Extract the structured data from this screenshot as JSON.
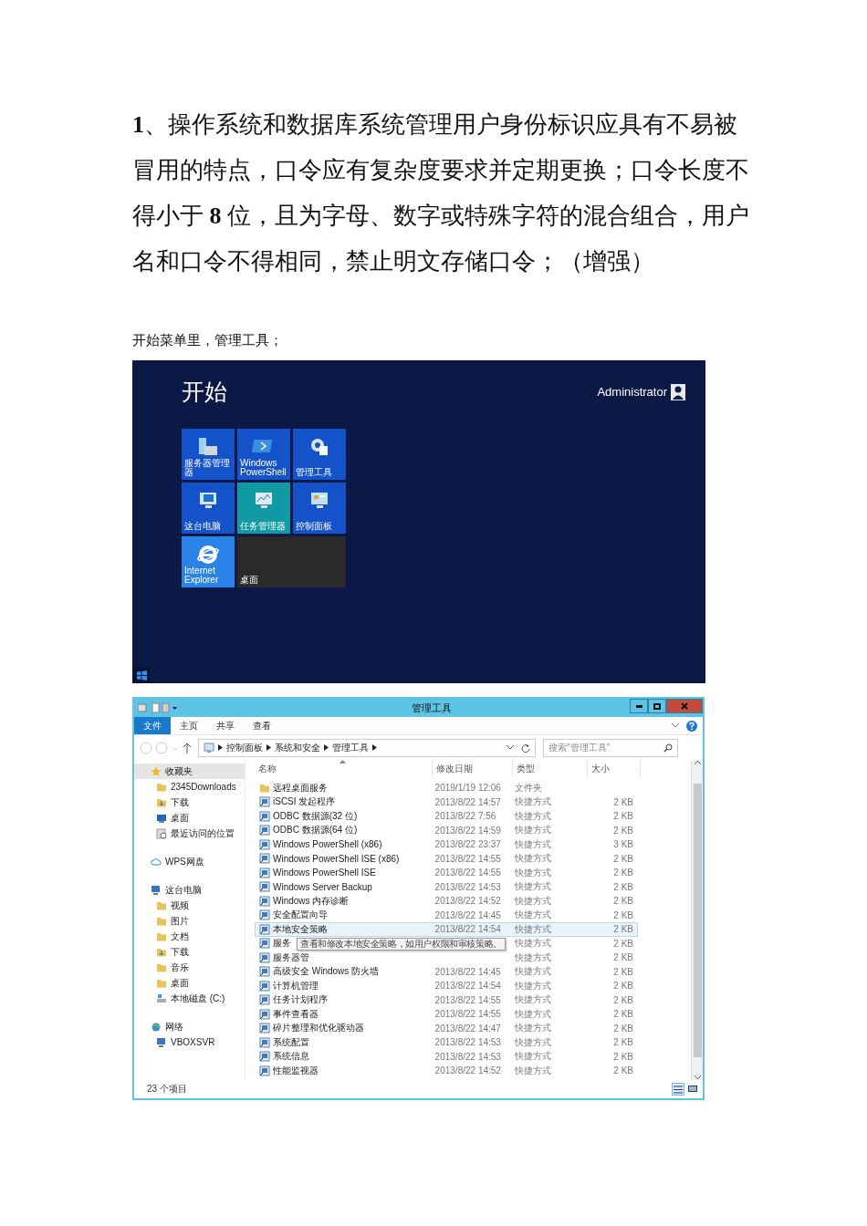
{
  "document": {
    "paragraph": "**1**、操作系统和数据库系统管理用户身份标识应具有不易被冒用的特点，口令应有复杂度要求并定期更换；口令长度不得小于 **8** 位，且为字母、数字或特殊字符的混合组合，用户名和口令不得相同，禁止明文存储口令；（增强）",
    "caption": "开始菜单里，管理工具；"
  },
  "start_screen": {
    "title": "开始",
    "user": "Administrator",
    "tiles": [
      {
        "label": "服务器管理器",
        "kind": "server",
        "color": "#1453c9"
      },
      {
        "label": "Windows PowerShell",
        "kind": "powershell",
        "color": "#1453c9"
      },
      {
        "label": "管理工具",
        "kind": "tools",
        "color": "#1453c9"
      },
      {
        "label": "这台电脑",
        "kind": "computer",
        "color": "#1453c9"
      },
      {
        "label": "任务管理器",
        "kind": "taskmgr",
        "color": "#129aa4"
      },
      {
        "label": "控制面板",
        "kind": "control",
        "color": "#1453c9"
      },
      {
        "label": "Internet Explorer",
        "kind": "ie",
        "color": "#2a84e8"
      },
      {
        "label": "桌面",
        "kind": "desktop",
        "color": "#2a2a2a"
      }
    ]
  },
  "explorer": {
    "title": "管理工具",
    "ribbon_tabs": [
      {
        "label": "文件",
        "selected": true
      },
      {
        "label": "主页",
        "selected": false
      },
      {
        "label": "共享",
        "selected": false
      },
      {
        "label": "查看",
        "selected": false
      }
    ],
    "breadcrumbs": [
      "控制面板",
      "系统和安全",
      "管理工具"
    ],
    "search": {
      "placeholder": "搜索\"管理工具\""
    },
    "nav": [
      {
        "label": "收藏夹",
        "kind": "favorites",
        "selected": true,
        "children": [
          {
            "label": "2345Downloads",
            "kind": "folder",
            "selected": false
          },
          {
            "label": "下载",
            "kind": "download",
            "selected": false
          },
          {
            "label": "桌面",
            "kind": "desktop",
            "selected": false
          },
          {
            "label": "最近访问的位置",
            "kind": "recent",
            "selected": false
          }
        ]
      },
      {
        "label": "WPS网盘",
        "kind": "cloud",
        "selected": false
      },
      {
        "label": "这台电脑",
        "kind": "computer",
        "selected": false,
        "children": [
          {
            "label": "视频",
            "kind": "folder",
            "selected": false
          },
          {
            "label": "图片",
            "kind": "folder",
            "selected": false
          },
          {
            "label": "文档",
            "kind": "folder",
            "selected": false
          },
          {
            "label": "下载",
            "kind": "download",
            "selected": false
          },
          {
            "label": "音乐",
            "kind": "folder",
            "selected": false
          },
          {
            "label": "桌面",
            "kind": "folder",
            "selected": false
          },
          {
            "label": "本地磁盘 (C:)",
            "kind": "drive",
            "selected": false
          }
        ]
      },
      {
        "label": "网络",
        "kind": "network",
        "selected": false,
        "children": [
          {
            "label": "VBOXSVR",
            "kind": "computer",
            "selected": false
          }
        ]
      }
    ],
    "columns": [
      {
        "label": "名称",
        "sorted": true
      },
      {
        "label": "修改日期",
        "sorted": false
      },
      {
        "label": "类型",
        "sorted": false
      },
      {
        "label": "大小",
        "sorted": false
      }
    ],
    "files": [
      {
        "name": "远程桌面服务",
        "kind": "folder",
        "modified": "2019/1/19 12:06",
        "type": "文件夹",
        "selected": false
      },
      {
        "name": "iSCSI 发起程序",
        "kind": "shortcut",
        "modified": "2013/8/22 14:57",
        "type": "快捷方式",
        "size": "2 KB",
        "selected": false
      },
      {
        "name": "ODBC 数据源(32 位)",
        "kind": "shortcut",
        "modified": "2013/8/22 7:56",
        "type": "快捷方式",
        "size": "2 KB",
        "selected": false
      },
      {
        "name": "ODBC 数据源(64 位)",
        "kind": "shortcut",
        "modified": "2013/8/22 14:59",
        "type": "快捷方式",
        "size": "2 KB",
        "selected": false
      },
      {
        "name": "Windows PowerShell (x86)",
        "kind": "shortcut",
        "modified": "2013/8/22 23:37",
        "type": "快捷方式",
        "size": "3 KB",
        "selected": false
      },
      {
        "name": "Windows PowerShell ISE (x86)",
        "kind": "shortcut",
        "modified": "2013/8/22 14:55",
        "type": "快捷方式",
        "size": "2 KB",
        "selected": false
      },
      {
        "name": "Windows PowerShell ISE",
        "kind": "shortcut",
        "modified": "2013/8/22 14:55",
        "type": "快捷方式",
        "size": "2 KB",
        "selected": false
      },
      {
        "name": "Windows Server Backup",
        "kind": "shortcut",
        "modified": "2013/8/22 14:53",
        "type": "快捷方式",
        "size": "2 KB",
        "selected": false
      },
      {
        "name": "Windows 内存诊断",
        "kind": "shortcut",
        "modified": "2013/8/22 14:52",
        "type": "快捷方式",
        "size": "2 KB",
        "selected": false
      },
      {
        "name": "安全配置向导",
        "kind": "shortcut",
        "modified": "2013/8/22 14:45",
        "type": "快捷方式",
        "size": "2 KB",
        "selected": false
      },
      {
        "name": "本地安全策略",
        "kind": "shortcut",
        "modified": "2013/8/22 14:54",
        "type": "快捷方式",
        "size": "2 KB",
        "selected": true
      },
      {
        "name": "服务",
        "kind": "shortcut",
        "type": "快捷方式",
        "size": "2 KB",
        "selected": false
      },
      {
        "name": "服务器管",
        "kind": "shortcut",
        "type": "快捷方式",
        "size": "2 KB",
        "selected": false
      },
      {
        "name": "高级安全 Windows 防火墙",
        "kind": "shortcut",
        "modified": "2013/8/22 14:45",
        "type": "快捷方式",
        "size": "2 KB",
        "selected": false
      },
      {
        "name": "计算机管理",
        "kind": "shortcut",
        "modified": "2013/8/22 14:54",
        "type": "快捷方式",
        "size": "2 KB",
        "selected": false
      },
      {
        "name": "任务计划程序",
        "kind": "shortcut",
        "modified": "2013/8/22 14:55",
        "type": "快捷方式",
        "size": "2 KB",
        "selected": false
      },
      {
        "name": "事件查看器",
        "kind": "shortcut",
        "modified": "2013/8/22 14:55",
        "type": "快捷方式",
        "size": "2 KB",
        "selected": false
      },
      {
        "name": "碎片整理和优化驱动器",
        "kind": "shortcut",
        "modified": "2013/8/22 14:47",
        "type": "快捷方式",
        "size": "2 KB",
        "selected": false
      },
      {
        "name": "系统配置",
        "kind": "shortcut",
        "modified": "2013/8/22 14:53",
        "type": "快捷方式",
        "size": "2 KB",
        "selected": false
      },
      {
        "name": "系统信息",
        "kind": "shortcut",
        "modified": "2013/8/22 14:53",
        "type": "快捷方式",
        "size": "2 KB",
        "selected": false
      },
      {
        "name": "性能监视器",
        "kind": "shortcut",
        "modified": "2013/8/22 14:52",
        "type": "快捷方式",
        "size": "2 KB",
        "selected": false
      }
    ],
    "tooltip": {
      "text": "查看和修改本地安全策略，如用户权限和审核策略。"
    },
    "status": "23 个项目"
  }
}
